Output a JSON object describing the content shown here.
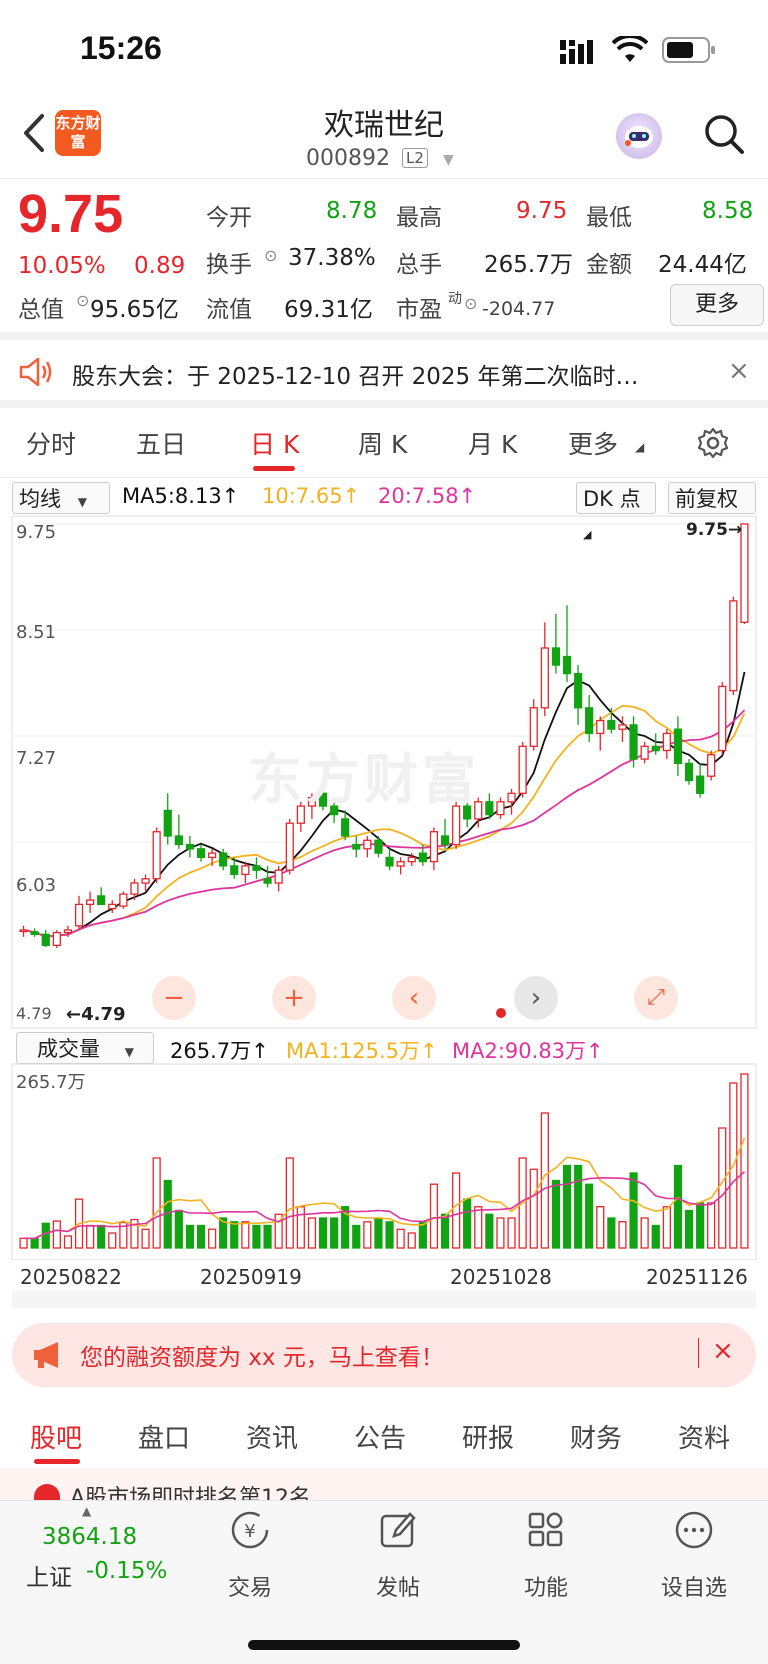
{
  "status": {
    "time": "15:26"
  },
  "header": {
    "title": "欢瑞世纪",
    "code": "000892",
    "level": "L2",
    "logo_text": "东方财富"
  },
  "quote": {
    "price": "9.75",
    "pct": "10.05%",
    "chg": "0.89",
    "open_label": "今开",
    "open": "8.78",
    "high_label": "最高",
    "high": "9.75",
    "low_label": "最低",
    "low": "8.58",
    "turnover_label": "换手",
    "turnover": "37.38%",
    "volume_label": "总手",
    "volume": "265.7万",
    "amount_label": "金额",
    "amount": "24.44亿",
    "mktcap_label": "总值",
    "mktcap": "95.65亿",
    "float_label": "流值",
    "float": "69.31亿",
    "pe_label": "市盈",
    "pe_sup": "动",
    "pe": "-204.77",
    "more": "更多"
  },
  "notice": {
    "text": "股东大会：于 2025-12-10 召开 2025 年第二次临时…",
    "close": "×"
  },
  "tabs": [
    "分时",
    "五日",
    "日 K",
    "周 K",
    "月 K",
    "更多"
  ],
  "active_tab": "日 K",
  "indicators": {
    "ma_select": "均线",
    "ma5": "MA5:8.13↑",
    "ma10": "10:7.65↑",
    "ma20": "20:7.58↑",
    "dk": "DK 点",
    "adjust": "前复权",
    "vol_select": "成交量",
    "vol": "265.7万↑",
    "vol_ma1": "MA1:125.5万↑",
    "vol_ma2": "MA2:90.83万↑"
  },
  "chart_labels": {
    "y_ticks": [
      "9.75",
      "8.51",
      "7.27",
      "6.03"
    ],
    "max_marker": "9.75→",
    "min_marker": "←4.79",
    "min_val": "4.79",
    "vol_max": "265.7万",
    "dates": [
      "20250822",
      "20250919",
      "20251028",
      "20251126"
    ],
    "watermark": "东方财富"
  },
  "colors": {
    "up": "#e5262b",
    "down": "#12a312",
    "ma5": "#111111",
    "ma10": "#f5b21f",
    "ma20": "#e0339d"
  },
  "chart_data": {
    "type": "candlestick",
    "ylim": [
      4.79,
      9.75
    ],
    "y_ticks": [
      9.75,
      8.51,
      7.27,
      6.03
    ],
    "ohlc": [
      [
        5.0,
        5.05,
        4.92,
        5.0
      ],
      [
        4.98,
        5.02,
        4.92,
        4.95
      ],
      [
        4.95,
        5.0,
        4.8,
        4.82
      ],
      [
        4.82,
        5.0,
        4.79,
        4.97
      ],
      [
        4.97,
        5.05,
        4.92,
        5.0
      ],
      [
        5.05,
        5.4,
        5.0,
        5.3
      ],
      [
        5.3,
        5.45,
        5.2,
        5.35
      ],
      [
        5.4,
        5.5,
        5.3,
        5.3
      ],
      [
        5.25,
        5.35,
        5.2,
        5.3
      ],
      [
        5.28,
        5.45,
        5.25,
        5.42
      ],
      [
        5.42,
        5.6,
        5.35,
        5.55
      ],
      [
        5.55,
        5.65,
        5.45,
        5.6
      ],
      [
        5.6,
        6.2,
        5.55,
        6.15
      ],
      [
        6.4,
        6.6,
        6.0,
        6.1
      ],
      [
        6.1,
        6.35,
        5.95,
        6.0
      ],
      [
        6.0,
        6.1,
        5.85,
        5.95
      ],
      [
        5.95,
        6.0,
        5.8,
        5.85
      ],
      [
        5.85,
        5.95,
        5.75,
        5.9
      ],
      [
        5.9,
        5.95,
        5.7,
        5.75
      ],
      [
        5.75,
        5.85,
        5.6,
        5.65
      ],
      [
        5.65,
        5.8,
        5.55,
        5.75
      ],
      [
        5.75,
        5.85,
        5.6,
        5.7
      ],
      [
        5.6,
        5.75,
        5.5,
        5.55
      ],
      [
        5.55,
        5.75,
        5.45,
        5.7
      ],
      [
        5.7,
        6.3,
        5.65,
        6.25
      ],
      [
        6.25,
        6.5,
        6.15,
        6.45
      ],
      [
        6.45,
        6.6,
        6.3,
        6.55
      ],
      [
        6.6,
        6.65,
        6.4,
        6.45
      ],
      [
        6.45,
        6.55,
        6.25,
        6.35
      ],
      [
        6.3,
        6.4,
        6.05,
        6.1
      ],
      [
        6.0,
        6.1,
        5.85,
        5.95
      ],
      [
        5.95,
        6.1,
        5.85,
        6.05
      ],
      [
        6.05,
        6.1,
        5.85,
        5.9
      ],
      [
        5.85,
        5.95,
        5.7,
        5.75
      ],
      [
        5.75,
        5.85,
        5.65,
        5.8
      ],
      [
        5.8,
        5.9,
        5.75,
        5.85
      ],
      [
        5.9,
        6.0,
        5.75,
        5.8
      ],
      [
        5.8,
        6.2,
        5.7,
        6.15
      ],
      [
        6.1,
        6.3,
        5.95,
        6.0
      ],
      [
        6.0,
        6.5,
        5.95,
        6.45
      ],
      [
        6.45,
        6.7,
        6.2,
        6.3
      ],
      [
        6.3,
        6.55,
        6.2,
        6.5
      ],
      [
        6.5,
        6.6,
        6.3,
        6.35
      ],
      [
        6.35,
        6.55,
        6.3,
        6.5
      ],
      [
        6.5,
        6.65,
        6.35,
        6.6
      ],
      [
        6.6,
        7.2,
        6.55,
        7.15
      ],
      [
        7.15,
        7.7,
        7.1,
        7.6
      ],
      [
        7.6,
        8.6,
        7.5,
        8.3
      ],
      [
        8.3,
        8.7,
        8.0,
        8.1
      ],
      [
        8.2,
        8.8,
        7.9,
        8.0
      ],
      [
        8.0,
        8.1,
        7.4,
        7.6
      ],
      [
        7.6,
        7.75,
        7.2,
        7.3
      ],
      [
        7.3,
        7.5,
        7.1,
        7.45
      ],
      [
        7.45,
        7.6,
        7.3,
        7.35
      ],
      [
        7.35,
        7.5,
        7.2,
        7.4
      ],
      [
        7.4,
        7.5,
        6.9,
        7.0
      ],
      [
        7.0,
        7.2,
        6.95,
        7.15
      ],
      [
        7.15,
        7.3,
        7.05,
        7.1
      ],
      [
        7.1,
        7.35,
        7.0,
        7.3
      ],
      [
        7.35,
        7.5,
        6.8,
        6.95
      ],
      [
        6.95,
        7.0,
        6.7,
        6.75
      ],
      [
        6.8,
        6.95,
        6.55,
        6.6
      ],
      [
        6.8,
        7.1,
        6.75,
        7.05
      ],
      [
        7.1,
        7.9,
        7.05,
        7.85
      ],
      [
        7.8,
        8.9,
        7.75,
        8.85
      ],
      [
        8.6,
        9.75,
        8.58,
        9.75
      ]
    ],
    "volume_max": "265.7万"
  },
  "controls": [
    "minus-button",
    "plus-button",
    "prev-button",
    "next-button",
    "fullscreen-button"
  ],
  "promo": {
    "text": "您的融资额度为 xx 元，马上查看！",
    "close": "×"
  },
  "bottom_tabs": [
    "股吧",
    "盘口",
    "资讯",
    "公告",
    "研报",
    "财务",
    "资料"
  ],
  "peek_text": "A股市场即时排名第12名",
  "nav": {
    "index_value": "3864.18",
    "index_name": "上证",
    "index_chg": "-0.15%",
    "items": [
      "交易",
      "发帖",
      "功能",
      "设自选"
    ]
  }
}
